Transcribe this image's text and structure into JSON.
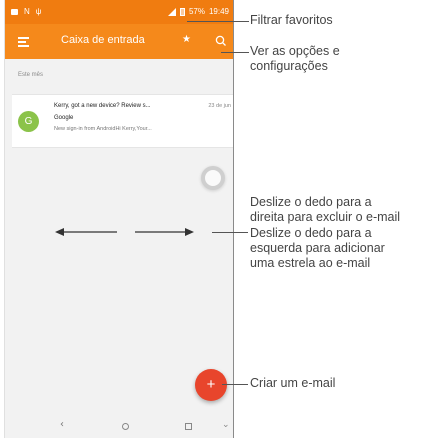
{
  "statusbar": {
    "battery": "57%",
    "time": "19:49"
  },
  "appbar": {
    "title": "Caixa de entrada"
  },
  "inbox": {
    "section_label": "Este mês",
    "email": {
      "avatar_letter": "G",
      "subject": "Kerry, got a new device? Review s...",
      "date": "23 de jun",
      "sender": "Google",
      "preview": "New sign-in from AndroidHi Kerry,Your..."
    }
  },
  "fab": {
    "symbol": "+"
  },
  "callouts": {
    "filter_favorites": "Filtrar favoritos",
    "options_line1": "Ver as opções e",
    "options_line2": "configurações",
    "swipe_right_line1": "Deslize o dedo para a",
    "swipe_right_line2": "direita para excluir o e-mail",
    "swipe_left_line1": "Deslize o dedo para a",
    "swipe_left_line2": "esquerda para adicionar",
    "swipe_left_line3": "uma estrela ao e-mail",
    "compose": "Criar um e-mail"
  },
  "colors": {
    "statusbar": "#f07c10",
    "appbar": "#f5891b",
    "fab": "#e8452c",
    "avatar": "#8bc34a"
  },
  "icons": [
    "menu-icon",
    "star-icon",
    "search-icon",
    "refresh-icon",
    "arrow-left-icon",
    "arrow-right-icon",
    "back-icon",
    "home-icon",
    "recents-icon",
    "chevron-down-icon"
  ]
}
